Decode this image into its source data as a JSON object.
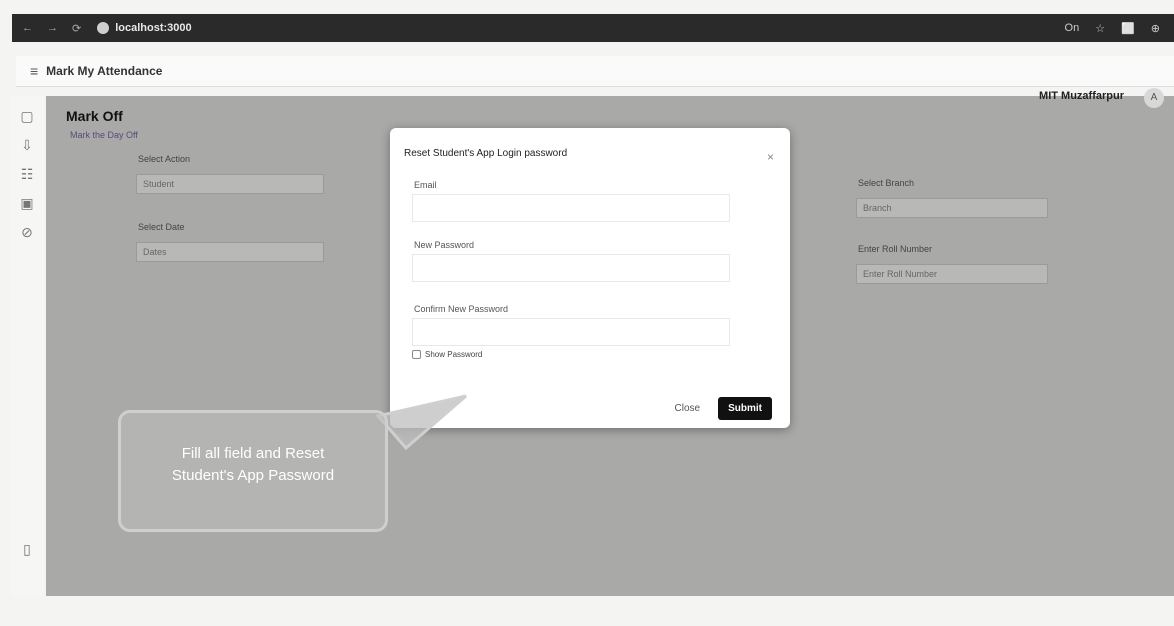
{
  "browser": {
    "url": "localhost:3000",
    "nav_back": "←",
    "nav_forward": "→",
    "nav_reload": "⟳",
    "right_icons": [
      "On",
      "☆",
      "⬜",
      "⊕"
    ]
  },
  "header": {
    "menu_icon": "≡",
    "title": "Mark My Attendance",
    "org_name": "MIT Muzaffarpur",
    "avatar_letter": "A"
  },
  "sidebar": {
    "icons": [
      "▢",
      "⇩",
      "☷",
      "▣",
      "⊘",
      "▯"
    ]
  },
  "page": {
    "heading": "Mark Off",
    "subheading": "Mark the Day Off",
    "left_labels": [
      {
        "label": "Select Action",
        "value": "Student"
      },
      {
        "label": "Select Date",
        "value": "Dates"
      }
    ],
    "right_labels": [
      {
        "label": "Select Branch",
        "value": "Branch"
      },
      {
        "label": "Enter Roll Number",
        "value": "Enter Roll Number"
      }
    ]
  },
  "modal": {
    "title": "Reset Student's App Login password",
    "close_icon": "×",
    "fields": [
      {
        "label": "Email"
      },
      {
        "label": "New Password"
      },
      {
        "label": "Confirm New Password"
      }
    ],
    "show_password": "Show Password",
    "close_label": "Close",
    "submit_label": "Submit"
  },
  "callout": {
    "line1": "Fill all field and Reset",
    "line2": "Student's App Password"
  },
  "colors": {
    "overlay": "#a9a9a7",
    "modal_bg": "#ffffff",
    "submit_bg": "#111111",
    "browser_bar": "#2a2a2a"
  }
}
